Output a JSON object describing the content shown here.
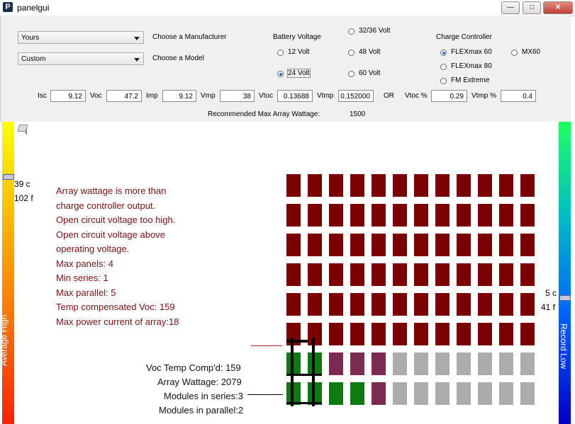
{
  "window": {
    "title": "panelgui",
    "app_icon": "P"
  },
  "controls": {
    "manufacturer": {
      "value": "Yours",
      "label": "Choose a Manufacturer"
    },
    "model": {
      "value": "Custom",
      "label": "Choose a Model"
    },
    "battery_voltage": {
      "title": "Battery Voltage",
      "options": [
        "32/36 Volt",
        "12 Volt",
        "48 Volt",
        "24 Volt",
        "60 Volt"
      ],
      "selected": "24 Volt"
    },
    "charge_controller": {
      "title": "Charge Controller",
      "options": [
        "FLEXmax 60",
        "MX60",
        "FLEXmax 80",
        "FM Extreme"
      ],
      "selected": "FLEXmax 60"
    },
    "fields": [
      {
        "label": "Isc",
        "value": "9.12"
      },
      {
        "label": "Voc",
        "value": "47.2"
      },
      {
        "label": "Imp",
        "value": "9.12"
      },
      {
        "label": "Vmp",
        "value": "38"
      },
      {
        "label": "Vtoc",
        "value": "0.13688"
      },
      {
        "label": "Vtmp",
        "value": "0.152000"
      }
    ],
    "or_label": "OR",
    "pct_fields": [
      {
        "label": "Vtoc %",
        "value": "0.29"
      },
      {
        "label": "Vtmp %",
        "value": "0.4"
      }
    ],
    "recommended": {
      "label": "Recommended Max Array Wattage:",
      "value": "1500"
    }
  },
  "temp_left": {
    "label": "Average High",
    "c": "39 c",
    "f": "102 f",
    "level": 0.18
  },
  "temp_right": {
    "label": "Record Low",
    "c": "5 c",
    "f": "41 f",
    "level": 0.58
  },
  "messages": [
    "Array wattage is more than",
    "charge controller output.",
    "Open circuit voltage too high.",
    "Open circuit voltage above",
    "operating voltage.",
    "Max panels: 4",
    "Min series: 1",
    "Max parallel: 5",
    "Temp compensated Voc: 159",
    "Max power current of array:18"
  ],
  "summary": {
    "voc_temp": "Voc Temp Comp'd: 159",
    "wattage": "Array Wattage: 2079",
    "series": "Modules in series:3",
    "parallel": "Modules in parallel:2"
  },
  "panel_grid": {
    "colors": {
      "dark_red": "#7b0000",
      "green": "#0f7a0f",
      "purple": "#7b2a52",
      "gray": "#acacac"
    },
    "rows": [
      [
        "r",
        "r",
        "r",
        "r",
        "r",
        "r",
        "r",
        "r",
        "r",
        "r",
        "r",
        "r"
      ],
      [
        "r",
        "r",
        "r",
        "r",
        "r",
        "r",
        "r",
        "r",
        "r",
        "r",
        "r",
        "r"
      ],
      [
        "r",
        "r",
        "r",
        "r",
        "r",
        "r",
        "r",
        "r",
        "r",
        "r",
        "r",
        "r"
      ],
      [
        "r",
        "r",
        "r",
        "r",
        "r",
        "r",
        "r",
        "r",
        "r",
        "r",
        "r",
        "r"
      ],
      [
        "r",
        "r",
        "r",
        "r",
        "r",
        "r",
        "r",
        "r",
        "r",
        "r",
        "r",
        "r"
      ],
      [
        "r",
        "r",
        "r",
        "r",
        "r",
        "r",
        "r",
        "r",
        "r",
        "r",
        "r",
        "r"
      ],
      [
        "g",
        "g",
        "p",
        "p",
        "p",
        "x",
        "x",
        "x",
        "x",
        "x",
        "x",
        "x"
      ],
      [
        "g",
        "g",
        "g",
        "g",
        "p",
        "x",
        "x",
        "x",
        "x",
        "x",
        "x",
        "x"
      ]
    ]
  }
}
